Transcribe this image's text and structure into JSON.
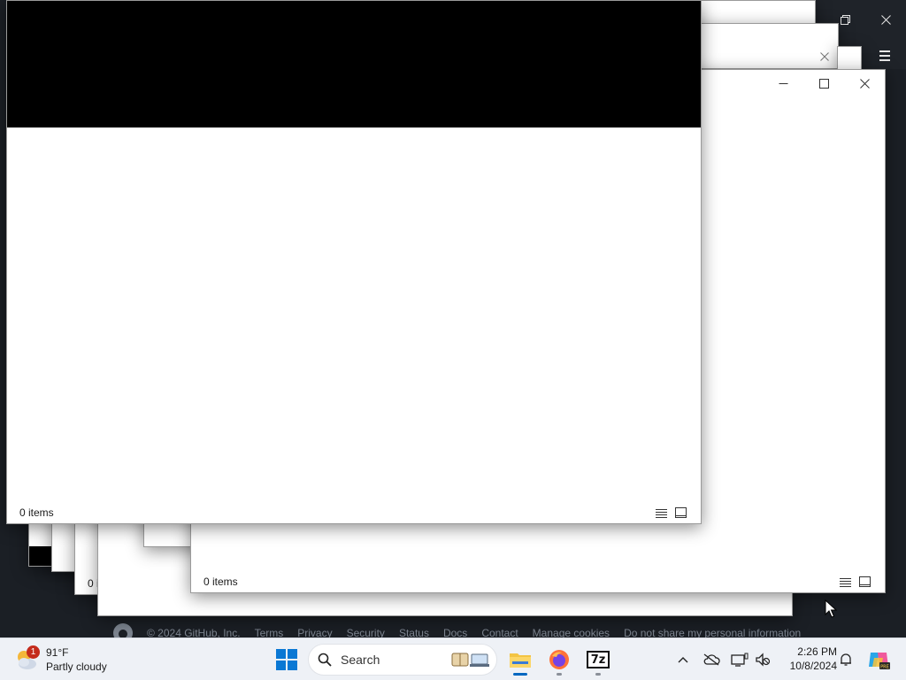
{
  "footer": {
    "copyright": "© 2024 GitHub, Inc.",
    "links": [
      "Terms",
      "Privacy",
      "Security",
      "Status",
      "Docs",
      "Contact",
      "Manage cookies",
      "Do not share my personal information"
    ]
  },
  "windows": {
    "items_label": "0 items",
    "partial_label_back": "0 i"
  },
  "taskbar": {
    "weather": {
      "badge": "1",
      "temperature": "91°F",
      "condition": "Partly cloudy"
    },
    "search": {
      "placeholder": "Search"
    },
    "apps": [
      {
        "name": "File Explorer",
        "icon": "folder-icon",
        "active": true
      },
      {
        "name": "Firefox",
        "icon": "firefox-icon",
        "running": true
      },
      {
        "name": "7-Zip",
        "icon": "7zip-icon",
        "label": "7z",
        "running": true
      }
    ],
    "clock": {
      "time": "2:26 PM",
      "date": "10/8/2024"
    }
  },
  "colors": {
    "desktop": "#1b1f25",
    "taskbar": "#eef1f6",
    "accent": "#0067c0",
    "badge": "#c42b1c"
  }
}
